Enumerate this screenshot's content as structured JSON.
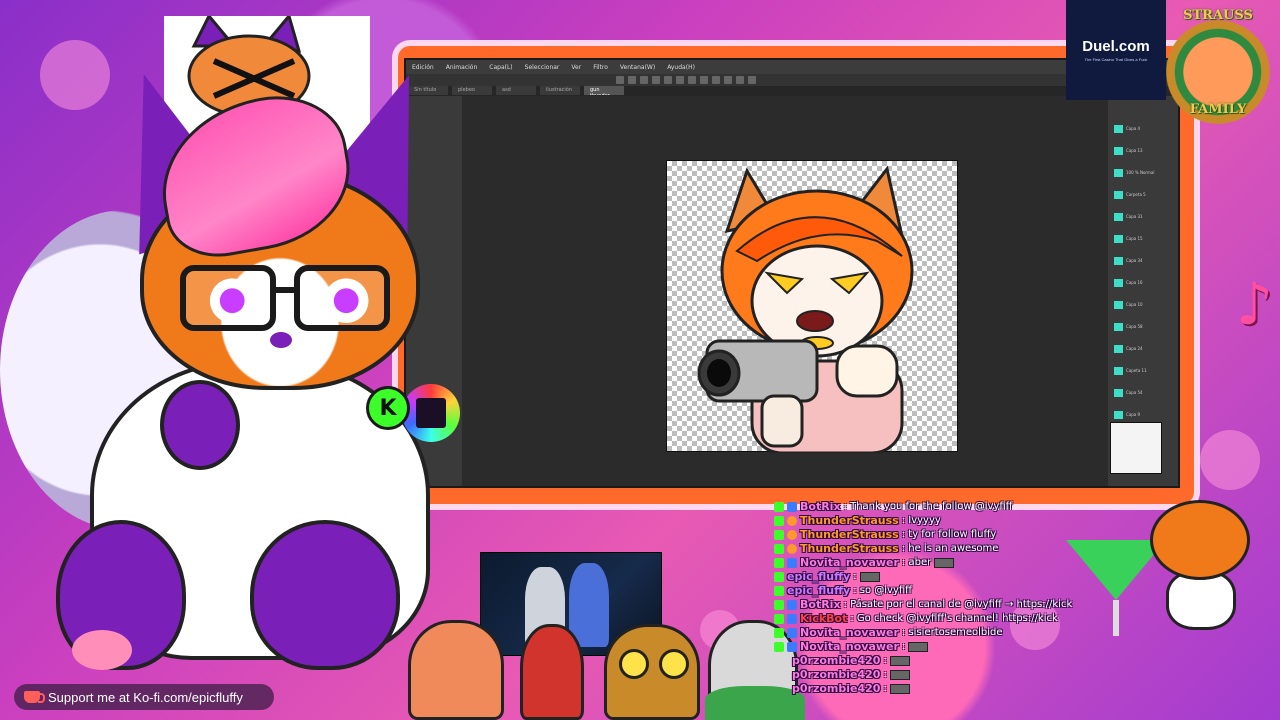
{
  "drawing_app": {
    "menu": [
      "Edición",
      "Animación",
      "Capa(L)",
      "Seleccionar",
      "Ver",
      "Filtro",
      "Ventana(W)",
      "Ayuda(H)"
    ],
    "tabs": [
      "Sin título",
      "plebeo",
      "asd",
      "ilustración",
      "gun thunder"
    ],
    "active_tab_index": 4,
    "layers": [
      "Capa 4",
      "Capa 13",
      "100 % Normal",
      "Carpeta 5",
      "Capa 31",
      "Capa 15",
      "Capa 34",
      "Capa 16",
      "Capa 10",
      "Capa 58",
      "Capa 24",
      "Capeta 11",
      "Capa 54",
      "Capa 9"
    ],
    "layer_color": "#3ddfc6"
  },
  "sponsor": {
    "name": "Duel.com",
    "tagline": "The First Casino That Gives a Fuck"
  },
  "badge": {
    "top": "STRAUSS",
    "bottom": "FAMILY"
  },
  "kick_letter": "K",
  "chat": [
    {
      "user": "BotRix",
      "msg": ": Thank you for the follow @ivyfiff",
      "user_color": "#ff7ae0"
    },
    {
      "user": "ThunderStrauss",
      "msg": ": Ivyyyy",
      "user_color": "#ff9a2a"
    },
    {
      "user": "ThunderStrauss",
      "msg": ": ty for follow fluffy",
      "user_color": "#ff9a2a"
    },
    {
      "user": "ThunderStrauss",
      "msg": ": he is an awesome",
      "user_color": "#ff9a2a"
    },
    {
      "user": "Novita_novawer",
      "msg": ": aber",
      "user_color": "#ff7ae0"
    },
    {
      "user": "epic_fluffy",
      "msg": ":",
      "user_color": "#c97aff"
    },
    {
      "user": "epic_fluffy",
      "msg": ": so @ivyfiff",
      "user_color": "#c97aff"
    },
    {
      "user": "BotRix",
      "msg": ": Pásate por el canal de @ivyfiff → https://kick",
      "user_color": "#ff7ae0"
    },
    {
      "user": "KickBot",
      "msg": ": Go check @ivyfiff's channel! https://kick",
      "user_color": "#ff4040"
    },
    {
      "user": "Novita_novawer",
      "msg": ": sisiertosemeolbide",
      "user_color": "#ff7ae0"
    },
    {
      "user": "Novita_novawer",
      "msg": ":",
      "user_color": "#ff7ae0"
    },
    {
      "user": "p0rzombie420",
      "msg": ":",
      "user_color": "#ff7ae0"
    },
    {
      "user": "p0rzombie420",
      "msg": ":",
      "user_color": "#ff7ae0"
    },
    {
      "user": "p0rzombie420",
      "msg": ":",
      "user_color": "#ff7ae0"
    }
  ],
  "kofi": {
    "text": "Support me at Ko-fi.com/epicfluffy"
  },
  "music_note": "♪"
}
